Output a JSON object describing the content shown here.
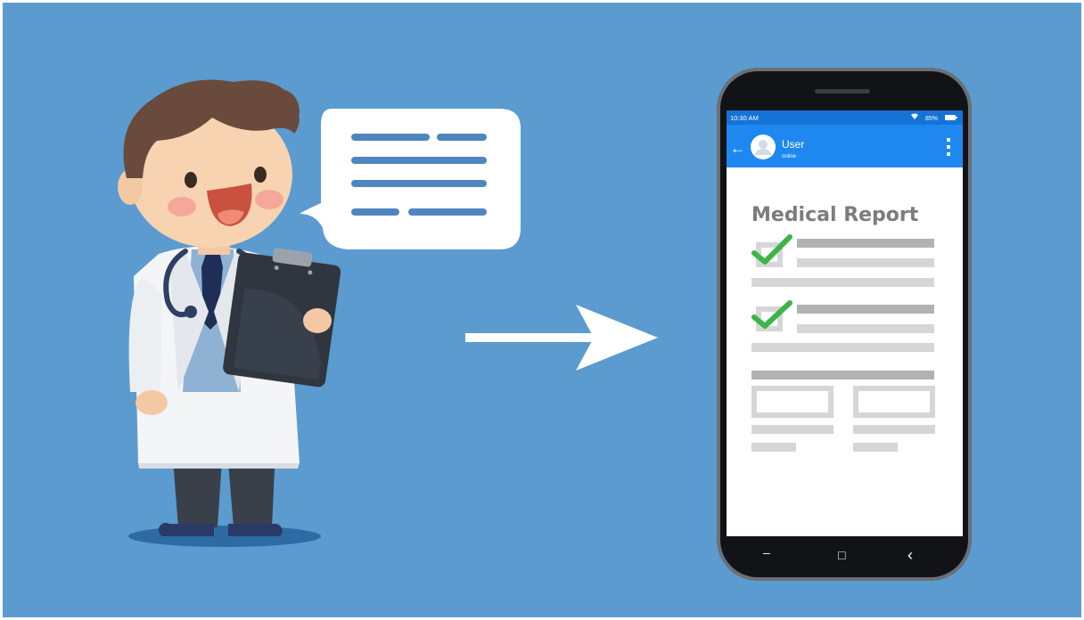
{
  "phone": {
    "status_time": "10:30 AM",
    "battery_percent": "85%",
    "chat_user_name": "User",
    "chat_user_status": "online",
    "back_glyph": "←",
    "report_title": "Medical Report",
    "checked_items": 2,
    "nav": {
      "recents_glyph": "–",
      "home_glyph": "□",
      "back_glyph": "‹"
    }
  },
  "colors": {
    "background": "#5b9bcf",
    "app_bar": "#1e88f0",
    "status_bar": "#1573d8",
    "check": "#3bb54a"
  },
  "icons": [
    "doctor-illustration",
    "speech-bubble-icon",
    "arrow-right-icon",
    "wifi-icon",
    "battery-icon",
    "avatar-icon",
    "more-vert-icon",
    "checkbox-checked-icon"
  ]
}
